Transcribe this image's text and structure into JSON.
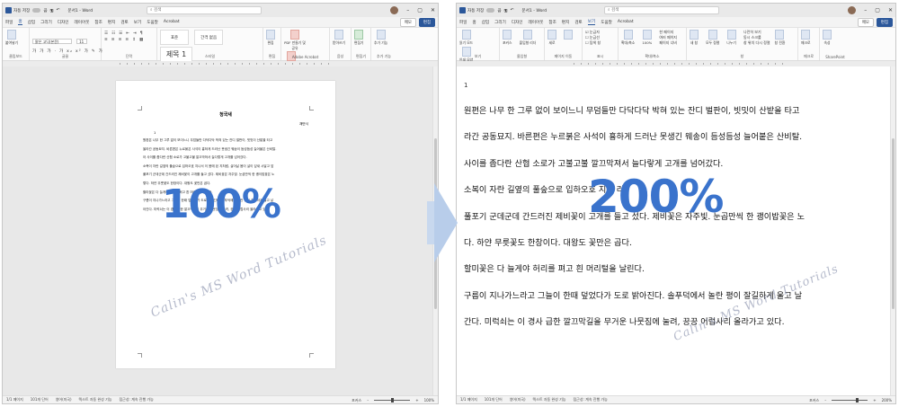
{
  "app": {
    "autosave_label": "자동 저장",
    "autosave_state": "끔",
    "doc_title": "문서1 - Word",
    "search_placeholder": "검색",
    "icons": {
      "word": "word-icon",
      "save": "save-icon",
      "undo": "undo-icon",
      "minimize": "minimize-icon",
      "maximize": "maximize-icon",
      "close": "close-icon"
    }
  },
  "left": {
    "tabs": [
      "파일",
      "홈",
      "삽입",
      "그리기",
      "디자인",
      "레이아웃",
      "참조",
      "편지",
      "검토",
      "보기",
      "도움말",
      "Acrobat"
    ],
    "active_tab": "홈",
    "memo_btn": "메모",
    "edit_btn": "편집",
    "ribbon": {
      "clipboard": {
        "paste": "붙여넣기",
        "label": "클립보드"
      },
      "font": {
        "name": "맑은 고딕(본문)",
        "size": "11",
        "label": "글꼴",
        "fmt": "가 가 가 · 가 x₂ x² 가 ✎ 가"
      },
      "para": {
        "label": "단락"
      },
      "styles": {
        "s1": "표준",
        "s2": "간격 없음",
        "s3": "제목 1",
        "label": "스타일"
      },
      "edit": {
        "find": "편집",
        "label": "편집"
      },
      "adobe": {
        "pdf": "PDF 만들기 및 공유",
        "sign": "서명 요청",
        "label": "Adobe Acrobat"
      },
      "voice": {
        "dictate": "받아쓰기",
        "label": "음성"
      },
      "editor": {
        "editor": "편집기",
        "label": "편집기"
      },
      "addins": {
        "addins": "추가 기능",
        "label": "추가 기능"
      }
    },
    "page": {
      "title": "청국새",
      "author": "채만식",
      "mark": "1",
      "lines": [
        "원편은 나무 한 그루 없이 보이느니 무덤들만 다닥다닥 박혀 있는 잔디 벌판이, 빗밋이 산밭을 타고",
        "올라간 공동묘지. 바른편은 누르붉은 사석이 흉하게 드러난 못생긴 웨송이 듬성듬성 늘어붙은 산비탈.",
        "아 사이를 좁다란 산협 소로가 고불고불 깔끄막져서 늘다랗게 고개를 넘어갔다.",
        "소복이 자란 길옆의 풀숲으로 입하오호 지나서 이 봄에 된 지처럼, 살어날 몸이 살이 잎새 시달고 앞",
        "풀포기 군데군데 간드러진 제비꽃이 고개를 들고 섰다. 제비꽃은 자주빛. 눈곱만씩 한 괭이밥꽃은 노",
        "랗다. 하얀 무릇꽃도 한창이다. 대왕도 꽃만은 곱다.",
        "할미꽃은 다 늘게야 허리를 펴고 흰 머리털을 날린다.",
        "구름이 지나가느라고 그늘이 한때 덮었다가 도로 밝아진다. 솔푸덕에서 놀란 평이 잘길하게 울고 날",
        "아간다. 미럭쇠는 이 경사 급한 깔끄막길을 무거운 나뭇짐에 눌려, 끙끙 어럽사리 올라가고 있다."
      ]
    },
    "status": {
      "page": "1/1 페이지",
      "words": "101개 단어",
      "lang": "영어(미국)",
      "predict": "텍스트 자동 완성 기능",
      "access": "접근성: 계속 진행 가능",
      "focus": "포커스",
      "zoom": "100%",
      "zoom_pct": 0.5
    }
  },
  "right": {
    "tabs": [
      "파일",
      "홈",
      "삽입",
      "그리기",
      "디자인",
      "레이아웃",
      "참조",
      "편지",
      "검토",
      "보기",
      "도움말",
      "Acrobat"
    ],
    "active_tab": "보기",
    "memo_btn": "메모",
    "edit_btn": "편집",
    "ribbon": {
      "views": {
        "read": "읽기 모드",
        "print": "인쇄 모양",
        "web": "웹 모양",
        "label": "보기"
      },
      "immersive": {
        "focus": "포커스",
        "reader": "몰입형 리더",
        "label": "몰입형"
      },
      "page_move": {
        "vertical": "세로",
        "side": "페이지 이동",
        "label": "페이지 이동"
      },
      "show": {
        "ruler": "눈금자",
        "grid": "눈금선",
        "nav": "탐색 창",
        "label": "표시"
      },
      "zoom": {
        "zoom": "확대/축소",
        "p100": "100%",
        "one": "한 페이지",
        "multi": "여러 페이지",
        "width": "페이지 너비",
        "label": "확대/축소"
      },
      "window": {
        "new": "새 창",
        "arrange": "모두 정렬",
        "split": "나누기",
        "side": "나란히 보기",
        "sync": "동시 스크롤",
        "reset": "창 위치 다시 정렬",
        "switch": "창 전환",
        "label": "창"
      },
      "macro": {
        "macro": "매크로",
        "label": "매크로"
      },
      "sharepoint": {
        "props": "속성",
        "label": "SharePoint"
      }
    },
    "doc": {
      "mark": "1",
      "lines": [
        "원편은 나무 한 그루 없이 보이느니 무덤들만 다닥다닥 박혀 있는 잔디 벌판이, 빗밋이 산밭을 타고",
        "라간 공동묘지. 바른편은 누르붉은 사석이 흉하게 드러난 못생긴 웨송이 듬성듬성 늘어붙은 산비탈.",
        " 사이를 좁다란 산협 소로가 고불고불 깔끄막져서 늘다랗게 고개를 넘어갔다.",
        "소복이 자란 길옆의 풀숲으로 입하오호 지나                  리",
        "풀포기 군데군데 간드러진 제비꽃이 고개를 들고 섰다. 제비꽃은 자주빛. 눈곱만씩 한 괭이밥꽃은 노",
        "다. 하얀 무릇꽃도 한창이다. 대왕도 꽃만은 곱다.",
        "할미꽃은 다 늘게야 허리를 펴고 흰 머리털을 날린다.",
        "구름이 지나가느라고 그늘이 한때 덮었다가 도로 밝아진다. 솔푸덕에서 놀란 평이 잘길하게 울고 날",
        "간다. 미럭쇠는 이 경사 급한 깔끄막길을 무거운 나뭇짐에 눌려, 끙끙 어럽사리 올라가고 있다."
      ]
    },
    "status": {
      "page": "1/1 페이지",
      "words": "101개 단어",
      "lang": "영어(미국)",
      "predict": "텍스트 자동 완성 기능",
      "access": "접근성: 계속 진행 가능",
      "focus": "포커스",
      "zoom": "200%",
      "zoom_pct": 0.72
    }
  },
  "overlay": {
    "zoom_left": "100%",
    "zoom_right": "200%",
    "watermark": "Calin's MS Word Tutorials",
    "arrow_color": "#b8cdea",
    "zoom_color": "#3a73cc"
  }
}
